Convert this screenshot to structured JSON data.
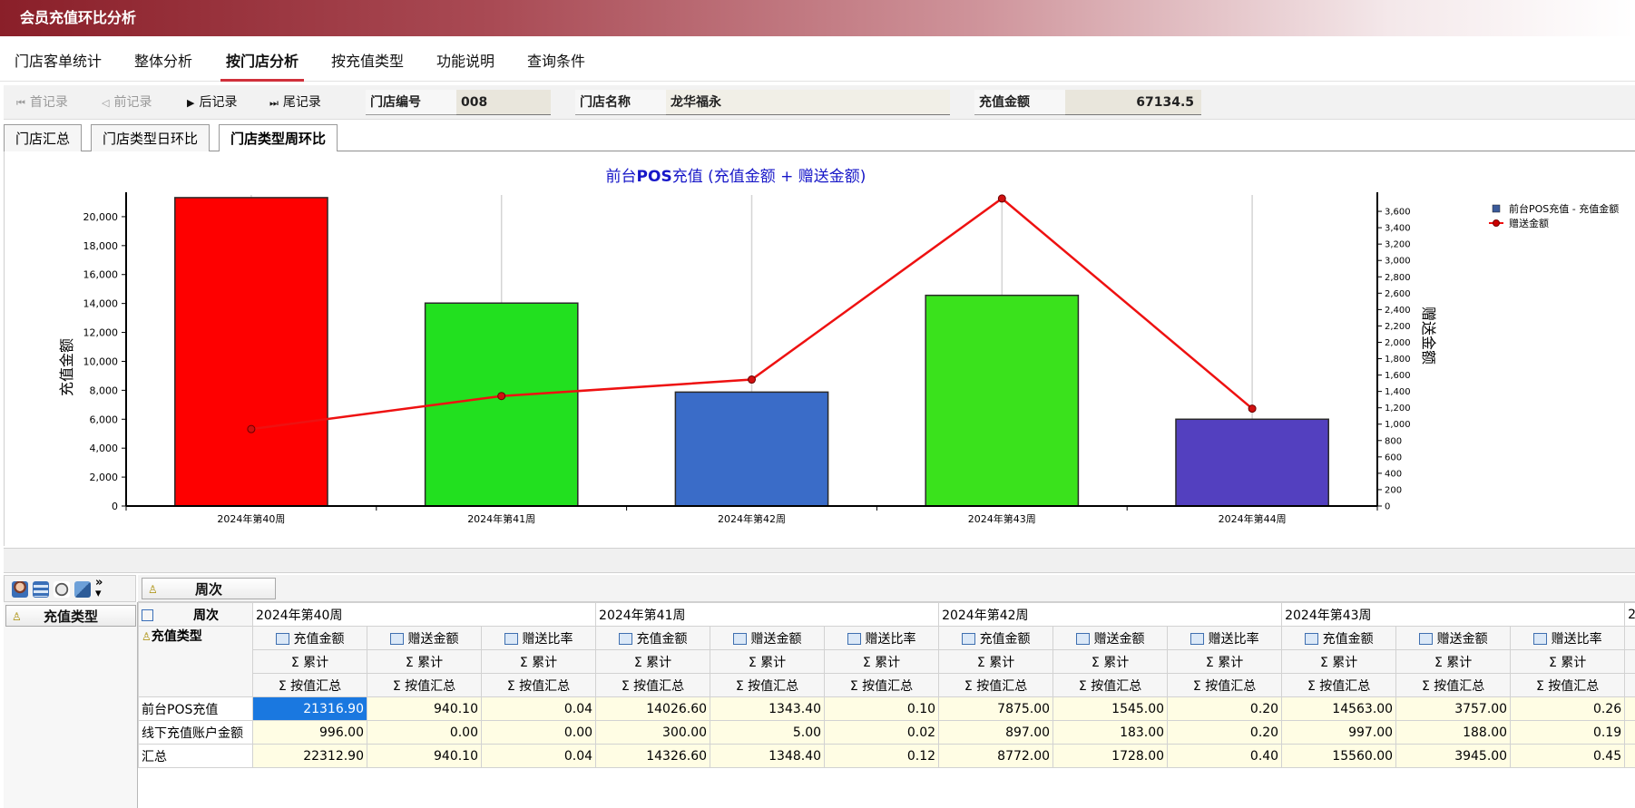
{
  "window": {
    "title": "会员充值环比分析"
  },
  "menu": [
    {
      "label": "门店客单统计"
    },
    {
      "label": "整体分析"
    },
    {
      "label": "按门店分析",
      "active": true
    },
    {
      "label": "按充值类型"
    },
    {
      "label": "功能说明"
    },
    {
      "label": "查询条件"
    }
  ],
  "toolbar": {
    "first": "首记录",
    "prev": "前记录",
    "next": "后记录",
    "last": "尾记录",
    "store_no_label": "门店编号",
    "store_no": "008",
    "store_name_label": "门店名称",
    "store_name": "龙华福永",
    "amount_label": "充值金额",
    "amount": "67134.5"
  },
  "subtabs": [
    {
      "label": "门店汇总"
    },
    {
      "label": "门店类型日环比"
    },
    {
      "label": "门店类型周环比",
      "active": true
    }
  ],
  "chart_data": {
    "type": "bar",
    "title_prefix": "前台",
    "title_bold": "POS",
    "title_suffix": "充值 (充值金额 + 赠送金额)",
    "categories": [
      "2024年第40周",
      "2024年第41周",
      "2024年第42周",
      "2024年第43周",
      "2024年第44周"
    ],
    "series": [
      {
        "name": "前台POS充值 - 充值金额",
        "type": "bar",
        "axis": "left",
        "values": [
          21316.9,
          14026.6,
          7875.0,
          14563.0,
          6000.0
        ],
        "colors": [
          "#fe0000",
          "#22e01f",
          "#3a6cc8",
          "#3ae21c",
          "#5340bf"
        ]
      },
      {
        "name": "赠送金额",
        "type": "line",
        "axis": "right",
        "values": [
          940.1,
          1343.4,
          1545.0,
          3757.0,
          1190.0
        ],
        "color": "#e11"
      }
    ],
    "ylabel": "充值金额",
    "y2label": "赠送金额",
    "ylim": [
      0,
      21500
    ],
    "yticks": [
      0,
      2000,
      4000,
      6000,
      8000,
      10000,
      12000,
      14000,
      16000,
      18000,
      20000
    ],
    "y2lim": [
      0,
      3800
    ],
    "y2ticks": [
      0,
      200,
      400,
      600,
      800,
      1000,
      1200,
      1400,
      1600,
      1800,
      2000,
      2200,
      2400,
      2600,
      2800,
      3000,
      3200,
      3400,
      3600
    ],
    "legend": "top-right",
    "grid": "vertical"
  },
  "pivot": {
    "col_field": "周次",
    "row_field_area": "充值类型",
    "row_field": "充值类型",
    "weeks": [
      "2024年第40周",
      "2024年第41周",
      "2024年第42周",
      "2024年第43周",
      "2"
    ],
    "measures": [
      "充值金额",
      "赠送金额",
      "赠送比率"
    ],
    "sum_label": "Σ 累计",
    "group_label": "Σ 按值汇总",
    "rows": [
      {
        "label": "前台POS充值",
        "cells": [
          "21316.90",
          "940.10",
          "0.04",
          "14026.60",
          "1343.40",
          "0.10",
          "7875.00",
          "1545.00",
          "0.20",
          "14563.00",
          "3757.00",
          "0.26"
        ]
      },
      {
        "label": "线下充值账户金额",
        "cells": [
          "996.00",
          "0.00",
          "0.00",
          "300.00",
          "5.00",
          "0.02",
          "897.00",
          "183.00",
          "0.20",
          "997.00",
          "188.00",
          "0.19"
        ]
      },
      {
        "label": "汇总",
        "cells": [
          "22312.90",
          "940.10",
          "0.04",
          "14326.60",
          "1348.40",
          "0.12",
          "8772.00",
          "1728.00",
          "0.40",
          "15560.00",
          "3945.00",
          "0.45"
        ]
      }
    ]
  }
}
